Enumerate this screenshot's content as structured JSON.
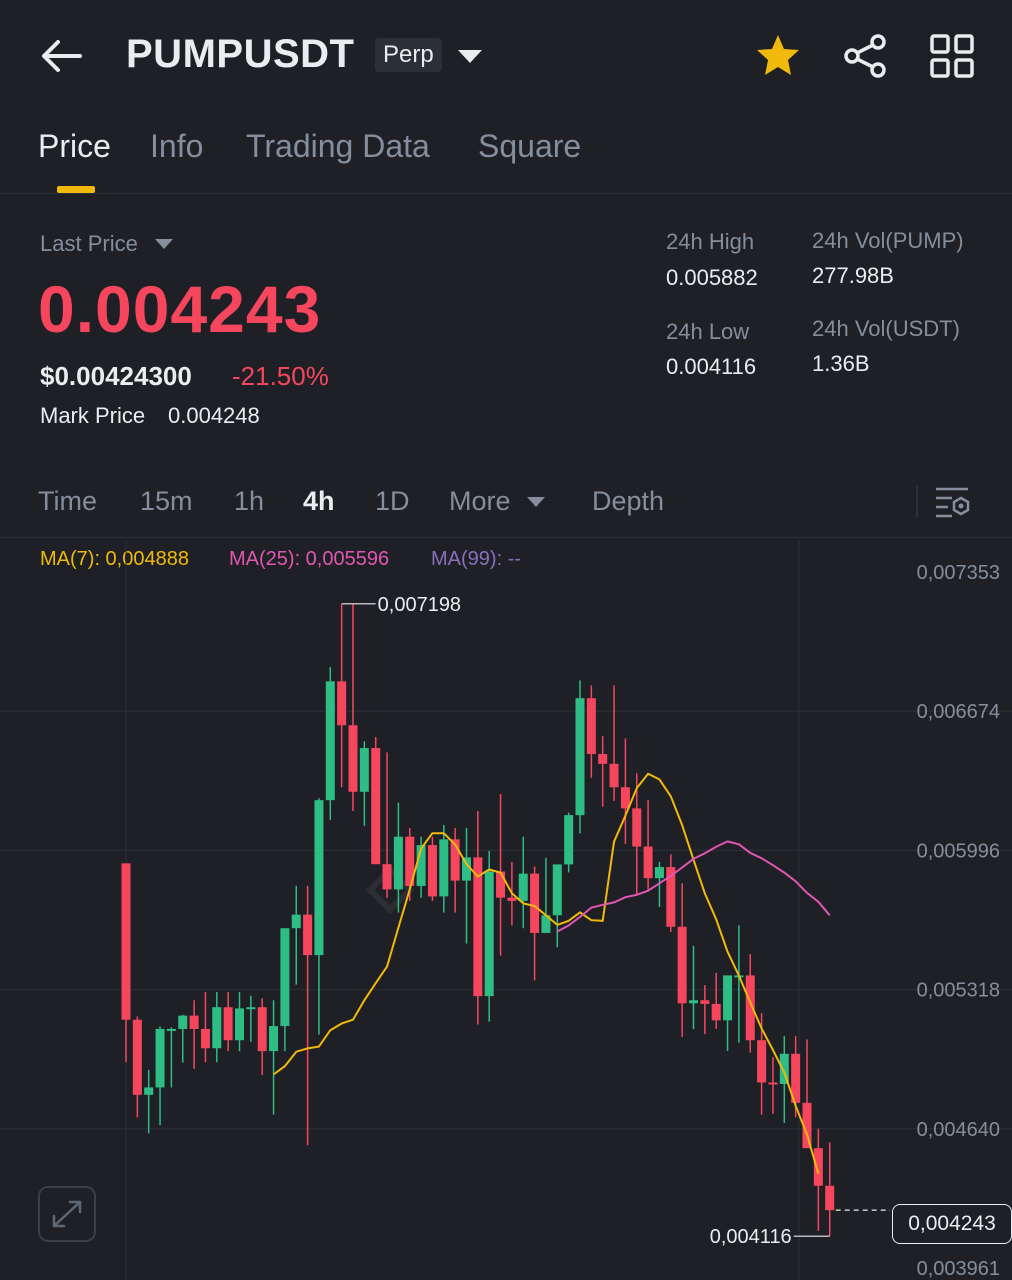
{
  "header": {
    "symbol": "PUMPUSDT",
    "contract_badge": "Perp",
    "icons": [
      "back-arrow-icon",
      "dropdown-caret-icon",
      "star-icon",
      "share-icon",
      "grid-menu-icon"
    ],
    "favorite": true
  },
  "tabs": [
    {
      "label": "Price",
      "active": true
    },
    {
      "label": "Info"
    },
    {
      "label": "Trading Data"
    },
    {
      "label": "Square"
    }
  ],
  "price": {
    "last_price_label": "Last Price",
    "last_price": "0.004243",
    "usd_price": "$0.00424300",
    "change_pct": "-21.50%",
    "mark_price_label": "Mark Price",
    "mark_price": "0.004248"
  },
  "stats": {
    "high_label": "24h High",
    "high": "0.005882",
    "low_label": "24h Low",
    "low": "0.004116",
    "vol_base_label": "24h Vol(PUMP)",
    "vol_base": "277.98B",
    "vol_quote_label": "24h Vol(USDT)",
    "vol_quote": "1.36B"
  },
  "intervals": {
    "items": [
      "Time",
      "15m",
      "1h",
      "4h",
      "1D",
      "More",
      "Depth"
    ],
    "active": "4h"
  },
  "indicators": {
    "ma7_label": "MA(7): 0,004888",
    "ma25_label": "MA(25): 0,005596",
    "ma99_label": "MA(99): --"
  },
  "colors": {
    "up": "#2ebd85",
    "down": "#f6465d",
    "accent": "#f0b90b",
    "ma7": "#f0b90b",
    "ma25": "#e256b3",
    "ma99": "#8a6fbf"
  },
  "chart_data": {
    "type": "candlestick",
    "y_ticks": [
      "0,007353",
      "0,006674",
      "0,005996",
      "0,005318",
      "0,004640",
      "0,003961"
    ],
    "ylim": [
      0.003961,
      0.007353
    ],
    "high_annotation": "0,007198",
    "low_annotation": "0,004116",
    "current_price_label": "0,004243",
    "candles": [
      {
        "o": 0.005933,
        "h": 0.005933,
        "l": 0.004964,
        "c": 0.005171
      },
      {
        "o": 0.005171,
        "h": 0.005187,
        "l": 0.004695,
        "c": 0.004805
      },
      {
        "o": 0.004805,
        "h": 0.004927,
        "l": 0.004617,
        "c": 0.004841
      },
      {
        "o": 0.004841,
        "h": 0.005138,
        "l": 0.004657,
        "c": 0.005126
      },
      {
        "o": 0.005126,
        "h": 0.005134,
        "l": 0.004841,
        "c": 0.005126
      },
      {
        "o": 0.005126,
        "h": 0.005195,
        "l": 0.004962,
        "c": 0.005191
      },
      {
        "o": 0.005191,
        "h": 0.005266,
        "l": 0.004932,
        "c": 0.005126
      },
      {
        "o": 0.005126,
        "h": 0.005306,
        "l": 0.004964,
        "c": 0.005032
      },
      {
        "o": 0.005032,
        "h": 0.005306,
        "l": 0.004964,
        "c": 0.005232
      },
      {
        "o": 0.005232,
        "h": 0.005306,
        "l": 0.005018,
        "c": 0.005071
      },
      {
        "o": 0.005071,
        "h": 0.005306,
        "l": 0.005018,
        "c": 0.005226
      },
      {
        "o": 0.005226,
        "h": 0.005288,
        "l": 0.005063,
        "c": 0.005232
      },
      {
        "o": 0.005232,
        "h": 0.005275,
        "l": 0.004902,
        "c": 0.005018
      },
      {
        "o": 0.005018,
        "h": 0.005266,
        "l": 0.004709,
        "c": 0.00514
      },
      {
        "o": 0.00514,
        "h": 0.005542,
        "l": 0.005018,
        "c": 0.005617
      },
      {
        "o": 0.005617,
        "h": 0.005824,
        "l": 0.005342,
        "c": 0.005683
      },
      {
        "o": 0.005683,
        "h": 0.005824,
        "l": 0.004559,
        "c": 0.005486
      },
      {
        "o": 0.005486,
        "h": 0.006251,
        "l": 0.005099,
        "c": 0.006241
      },
      {
        "o": 0.006241,
        "h": 0.00689,
        "l": 0.006145,
        "c": 0.00682
      },
      {
        "o": 0.00682,
        "h": 0.007198,
        "l": 0.006304,
        "c": 0.006606
      },
      {
        "o": 0.006606,
        "h": 0.007198,
        "l": 0.006188,
        "c": 0.006282
      },
      {
        "o": 0.006282,
        "h": 0.006528,
        "l": 0.006116,
        "c": 0.006495
      },
      {
        "o": 0.006495,
        "h": 0.006549,
        "l": 0.005956,
        "c": 0.005929
      },
      {
        "o": 0.005929,
        "h": 0.006474,
        "l": 0.005765,
        "c": 0.005806
      },
      {
        "o": 0.005806,
        "h": 0.006229,
        "l": 0.005693,
        "c": 0.006063
      },
      {
        "o": 0.006063,
        "h": 0.006105,
        "l": 0.00575,
        "c": 0.005823
      },
      {
        "o": 0.005823,
        "h": 0.006063,
        "l": 0.005765,
        "c": 0.006022
      },
      {
        "o": 0.006022,
        "h": 0.006063,
        "l": 0.00575,
        "c": 0.005772
      },
      {
        "o": 0.005772,
        "h": 0.00612,
        "l": 0.005693,
        "c": 0.00605
      },
      {
        "o": 0.00605,
        "h": 0.006105,
        "l": 0.005693,
        "c": 0.005849
      },
      {
        "o": 0.005849,
        "h": 0.006105,
        "l": 0.005542,
        "c": 0.005962
      },
      {
        "o": 0.005962,
        "h": 0.006188,
        "l": 0.005148,
        "c": 0.005286
      },
      {
        "o": 0.005286,
        "h": 0.005993,
        "l": 0.005162,
        "c": 0.005893
      },
      {
        "o": 0.005893,
        "h": 0.006271,
        "l": 0.005483,
        "c": 0.005766
      },
      {
        "o": 0.005766,
        "h": 0.00594,
        "l": 0.005631,
        "c": 0.00575
      },
      {
        "o": 0.00575,
        "h": 0.006063,
        "l": 0.005617,
        "c": 0.005883
      },
      {
        "o": 0.005883,
        "h": 0.005918,
        "l": 0.005363,
        "c": 0.005594
      },
      {
        "o": 0.005594,
        "h": 0.00596,
        "l": 0.005617,
        "c": 0.00568
      },
      {
        "o": 0.00568,
        "h": 0.005919,
        "l": 0.005524,
        "c": 0.005928
      },
      {
        "o": 0.005928,
        "h": 0.00618,
        "l": 0.005889,
        "c": 0.006168
      },
      {
        "o": 0.006168,
        "h": 0.006825,
        "l": 0.006079,
        "c": 0.006738
      },
      {
        "o": 0.006738,
        "h": 0.0068,
        "l": 0.00635,
        "c": 0.006466
      },
      {
        "o": 0.006466,
        "h": 0.006553,
        "l": 0.00621,
        "c": 0.006418
      },
      {
        "o": 0.006418,
        "h": 0.0068,
        "l": 0.006237,
        "c": 0.006304
      },
      {
        "o": 0.006304,
        "h": 0.006542,
        "l": 0.006028,
        "c": 0.006201
      },
      {
        "o": 0.006201,
        "h": 0.006372,
        "l": 0.005779,
        "c": 0.006015
      },
      {
        "o": 0.006015,
        "h": 0.006242,
        "l": 0.005806,
        "c": 0.005861
      },
      {
        "o": 0.005861,
        "h": 0.00594,
        "l": 0.005721,
        "c": 0.005915
      },
      {
        "o": 0.005915,
        "h": 0.005977,
        "l": 0.005598,
        "c": 0.005624
      },
      {
        "o": 0.005624,
        "h": 0.005836,
        "l": 0.005086,
        "c": 0.005251
      },
      {
        "o": 0.005251,
        "h": 0.005531,
        "l": 0.005125,
        "c": 0.005266
      },
      {
        "o": 0.005266,
        "h": 0.00534,
        "l": 0.005101,
        "c": 0.005248
      },
      {
        "o": 0.005248,
        "h": 0.0054,
        "l": 0.005126,
        "c": 0.005168
      },
      {
        "o": 0.005168,
        "h": 0.005382,
        "l": 0.005019,
        "c": 0.005387
      },
      {
        "o": 0.005387,
        "h": 0.005631,
        "l": 0.005059,
        "c": 0.005387
      },
      {
        "o": 0.005387,
        "h": 0.005491,
        "l": 0.005011,
        "c": 0.005071
      },
      {
        "o": 0.005071,
        "h": 0.005203,
        "l": 0.004708,
        "c": 0.004865
      },
      {
        "o": 0.004865,
        "h": 0.004989,
        "l": 0.004712,
        "c": 0.004858
      },
      {
        "o": 0.004858,
        "h": 0.005091,
        "l": 0.004668,
        "c": 0.005005
      },
      {
        "o": 0.005005,
        "h": 0.005091,
        "l": 0.004695,
        "c": 0.004766
      },
      {
        "o": 0.004766,
        "h": 0.005075,
        "l": 0.00464,
        "c": 0.004545
      },
      {
        "o": 0.004545,
        "h": 0.00464,
        "l": 0.004142,
        "c": 0.004362
      },
      {
        "o": 0.004362,
        "h": 0.004573,
        "l": 0.004116,
        "c": 0.004243
      }
    ],
    "ma7": [
      null,
      null,
      null,
      null,
      null,
      null,
      0.004904,
      0.004945,
      0.005015,
      0.005031,
      0.00504,
      0.00512,
      0.005152,
      0.005171,
      0.005266,
      0.005349,
      0.005431,
      0.00562,
      0.005807,
      0.006005,
      0.00608,
      0.00608,
      0.006025,
      0.00593,
      0.005869,
      0.005903,
      0.005888,
      0.005787,
      0.005738,
      0.005725,
      0.00568,
      0.005633,
      0.005653,
      0.005694,
      0.005656,
      0.005653,
      0.006038,
      0.006166,
      0.0063,
      0.00637,
      0.006342,
      0.00626,
      0.00612,
      0.005951,
      0.005786,
      0.00566,
      0.005503,
      0.005386,
      0.005255,
      0.005128,
      0.005024,
      0.004914,
      0.004752,
      0.004611,
      0.00442
    ],
    "ma25": [
      null,
      null,
      null,
      null,
      null,
      null,
      null,
      null,
      null,
      null,
      null,
      null,
      null,
      null,
      null,
      null,
      null,
      null,
      null,
      null,
      null,
      null,
      null,
      null,
      0.005601,
      0.00563,
      0.005672,
      0.005717,
      0.005731,
      0.005743,
      0.005768,
      0.00578,
      0.0058,
      0.005836,
      0.005872,
      0.005913,
      0.005955,
      0.005982,
      0.006014,
      0.00604,
      0.006026,
      0.005984,
      0.005958,
      0.005924,
      0.005888,
      0.005846,
      0.005789,
      0.005745,
      0.00568
    ]
  }
}
